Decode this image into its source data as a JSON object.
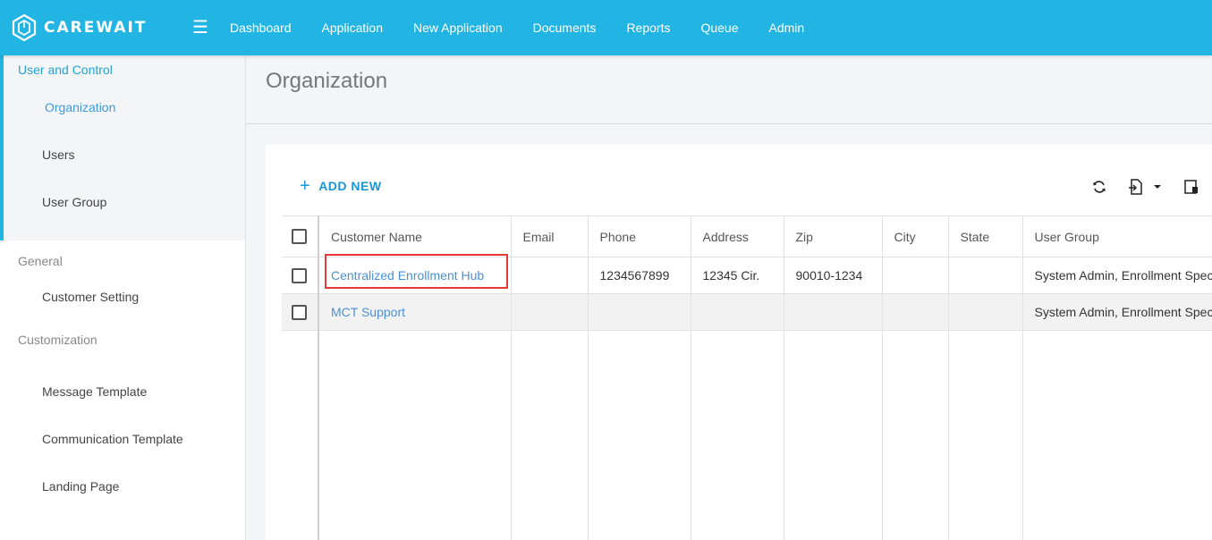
{
  "app": {
    "brand": "CAREWAIT",
    "brand_color": "#22b5e4"
  },
  "nav": {
    "items": [
      "Dashboard",
      "Application",
      "New Application",
      "Documents",
      "Reports",
      "Queue",
      "Admin"
    ]
  },
  "sidebar": {
    "group_user_control": "User and Control",
    "items_user_control": [
      "Organization",
      "Users",
      "User Group"
    ],
    "group_general": "General",
    "items_general": [
      "Customer Setting"
    ],
    "group_customization": "Customization",
    "items_customization": [
      "Message Template",
      "Communication Template",
      "Landing Page"
    ]
  },
  "page": {
    "title": "Organization"
  },
  "toolbar": {
    "add_new_label": "ADD NEW"
  },
  "table": {
    "columns": [
      "Customer Name",
      "Email",
      "Phone",
      "Address",
      "Zip",
      "City",
      "State",
      "User Group"
    ],
    "rows": [
      {
        "customer_name": "Centralized Enrollment Hub",
        "email": "",
        "phone": "1234567899",
        "address": "12345 Cir.",
        "zip": "90010-1234",
        "city": "",
        "state": "",
        "user_group": "System Admin, Enrollment Specialist"
      },
      {
        "customer_name": "MCT Support",
        "email": "",
        "phone": "",
        "address": "",
        "zip": "",
        "city": "",
        "state": "",
        "user_group": "System Admin, Enrollment Specialist"
      }
    ]
  }
}
